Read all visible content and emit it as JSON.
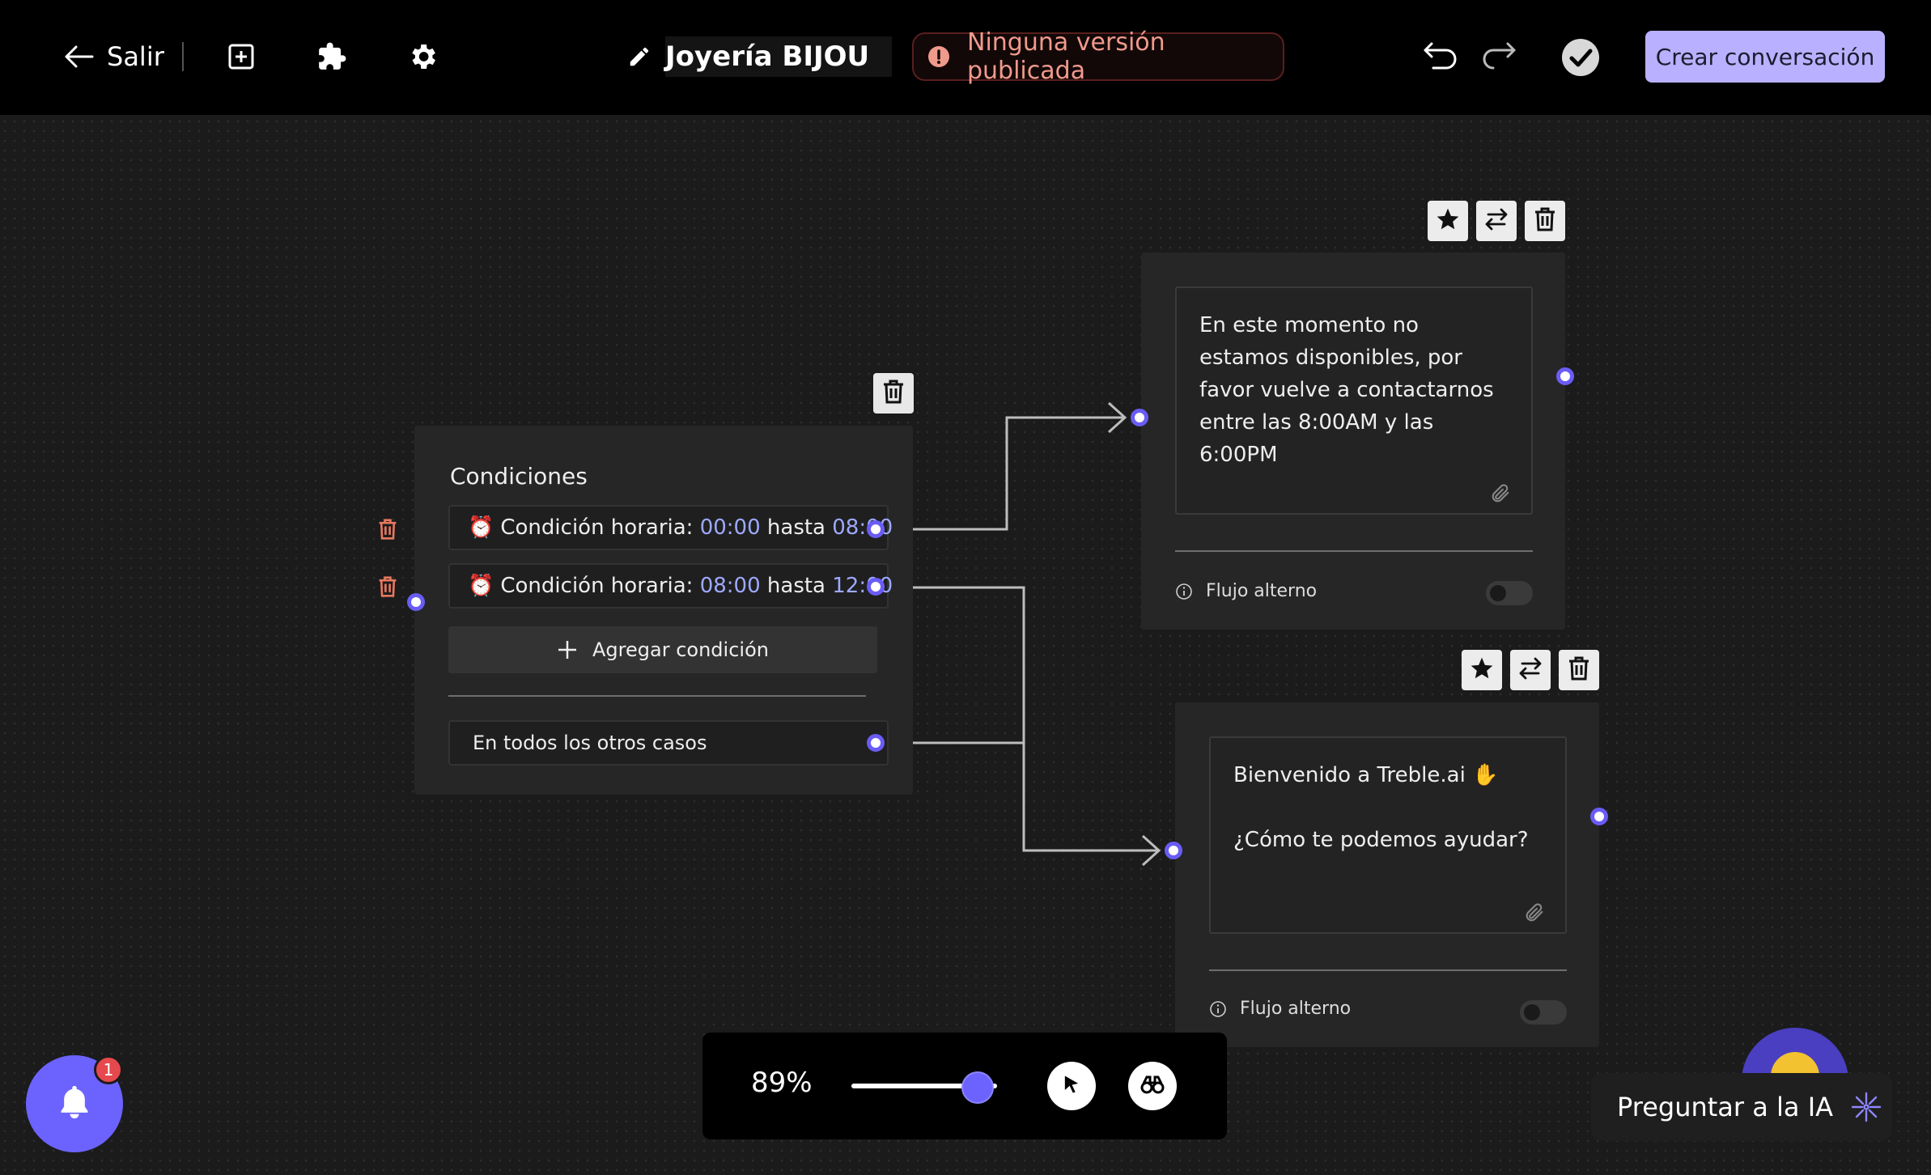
{
  "header": {
    "exit_label": "Salir",
    "title": "Joyería BIJOU",
    "status": "Ninguna versión publicada",
    "create_button": "Crear conversación"
  },
  "condition_node": {
    "title": "Condiciones",
    "conditions": [
      {
        "label": "Condición horaria:",
        "from": "00:00",
        "sep": "hasta",
        "to": "08:00"
      },
      {
        "label": "Condición horaria:",
        "from": "08:00",
        "sep": "hasta",
        "to": "12:00"
      }
    ],
    "add_condition": "Agregar condición",
    "otherwise": "En todos los otros casos"
  },
  "message_nodes": [
    {
      "text": "En este momento no estamos disponibles, por favor vuelve a contactarnos entre las 8:00AM y las 6:00PM",
      "alt_flow": "Flujo alterno"
    },
    {
      "text": "Bienvenido a Treble.ai ✋\n\n¿Cómo te podemos ayudar?",
      "alt_flow": "Flujo alterno"
    }
  ],
  "zoom": {
    "label": "89%",
    "value": 0.89
  },
  "notifications": {
    "count": "1"
  },
  "ask_ai": "Preguntar a la IA",
  "colors": {
    "accent": "#6c63ff",
    "create_button": "#b9b1ff",
    "status_text": "#f09a8c",
    "highlight": "#9ea9ff",
    "delete_red": "#e8785f"
  },
  "icons": [
    "arrow-left-icon",
    "add-square-icon",
    "puzzle-icon",
    "gear-icon",
    "pencil-icon",
    "alert-icon",
    "undo-icon",
    "redo-icon",
    "check-circle-icon",
    "trash-icon",
    "star-icon",
    "swap-icon",
    "alarm-icon",
    "plus-icon",
    "paperclip-icon",
    "info-icon",
    "cursor-icon",
    "binoculars-icon",
    "bell-icon",
    "sparkle-icon"
  ]
}
